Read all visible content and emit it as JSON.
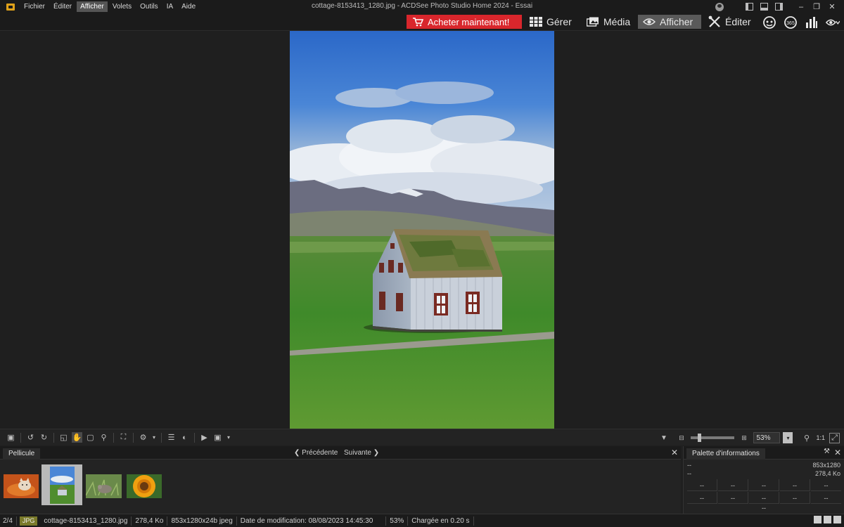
{
  "app": {
    "window_title": "cottage-8153413_1280.jpg - ACDSee Photo Studio Home 2024 - Essai"
  },
  "menu": {
    "items": [
      {
        "label": "Fichier",
        "active": false
      },
      {
        "label": "Éditer",
        "active": false
      },
      {
        "label": "Afficher",
        "active": true
      },
      {
        "label": "Volets",
        "active": false
      },
      {
        "label": "Outils",
        "active": false
      },
      {
        "label": "IA",
        "active": false
      },
      {
        "label": "Aide",
        "active": false
      }
    ]
  },
  "modes": {
    "buy_label": "Acheter maintenant!",
    "manage_label": "Gérer",
    "media_label": "Média",
    "view_label": "Afficher",
    "edit_label": "Éditer",
    "active": "view"
  },
  "toolbar": {
    "zoom_value": "53%",
    "one_to_one": "1:1"
  },
  "filmstrip": {
    "tab_label": "Pellicule",
    "prev_label": "Précédente",
    "next_label": "Suivante",
    "selected_index": 1,
    "thumbnails": [
      {
        "subject": "cat-on-orange"
      },
      {
        "subject": "cottage"
      },
      {
        "subject": "mouse-in-grass"
      },
      {
        "subject": "sunflower"
      }
    ]
  },
  "info_palette": {
    "title": "Palette d'informations",
    "row1_left": "--",
    "row1_right": "853x1280",
    "row2_left": "--",
    "row2_right": "278,4 Ko",
    "grid": [
      "--",
      "--",
      "--",
      "--",
      "--",
      "--",
      "--",
      "--",
      "--",
      "--"
    ],
    "footer": "--"
  },
  "status": {
    "position": "2/4",
    "format": "JPG",
    "filename": "cottage-8153413_1280.jpg",
    "filesize": "278,4 Ko",
    "dimensions": "853x1280x24b jpeg",
    "modified": "Date de modification: 08/08/2023 14:45:30",
    "zoom": "53%",
    "load_time": "Chargée en  0.20 s"
  },
  "colors": {
    "buy_red": "#d9262c",
    "active_mode": "#5a5a5a",
    "background": "#1f1f1f"
  }
}
